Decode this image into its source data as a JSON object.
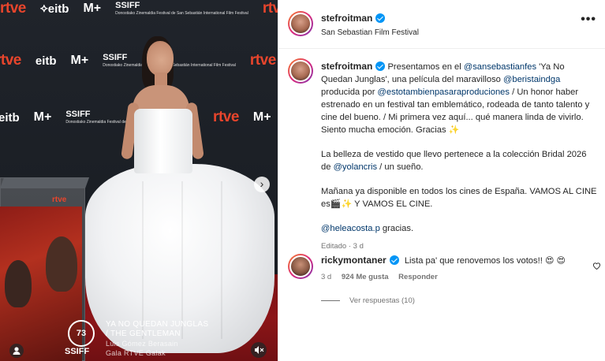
{
  "media": {
    "logos": [
      "rtve",
      "eitb",
      "M+",
      "SSIFF"
    ],
    "ssiff_small": "Donostiako Zinemaldia Festival de San Sebastián International Film Festival",
    "ssiff_number": "73",
    "ssiff_word": "SSIFF",
    "caption_line1": "YA NO QUEDAN JUNGLAS",
    "caption_line2": "/ THE GENTLEMAN",
    "caption_line3": "Luis Gómez Berasain",
    "caption_line4": "Gala RTVE Galak",
    "poster_logo": "rtve",
    "nav_arrow": "›"
  },
  "header": {
    "username": "stefroitman",
    "location": "San Sebastian Film Festival",
    "more": "•••"
  },
  "post": {
    "username": "stefroitman",
    "p1": {
      "t1": "Presentamos en el ",
      "m1": "@sansebastianfes",
      "t2": " 'Ya No Quedan Junglas', una película del maravilloso ",
      "m2": "@beristaindga",
      "t3": " producida por ",
      "m3": "@estotambienpasaraproduciones",
      "t4": " / Un honor haber estrenado en un festival tan emblemático, rodeada de tanto talento y cine del bueno. / Mi primera vez aquí... qué manera linda de vivirlo. Siento mucha emoción. Gracias ",
      "e1": "✨"
    },
    "p2": {
      "t1": "La belleza de vestido que llevo pertenece a la colección Bridal 2026 de ",
      "m1": "@yolancris",
      "t2": " / un sueño."
    },
    "p3": {
      "t1": "Mañana ya disponible en todos los cines de España. VAMOS AL CINE es",
      "e1": "🎬✨",
      "t2": " Y VAMOS EL CINE."
    },
    "p4": {
      "m1": "@heleacosta.p",
      "t1": " gracias."
    },
    "meta": "Editado · 3 d"
  },
  "comment": {
    "username": "rickymontaner",
    "text": "Lista pa' que renovemos los votos!! ",
    "emoji": "😍 😍",
    "time": "3 d",
    "likes": "924 Me gusta",
    "reply": "Responder",
    "view_replies": "Ver respuestas (10)"
  },
  "colors": {
    "verified": "#0095f6",
    "link": "#00376b",
    "rtve": "#e8452c"
  }
}
